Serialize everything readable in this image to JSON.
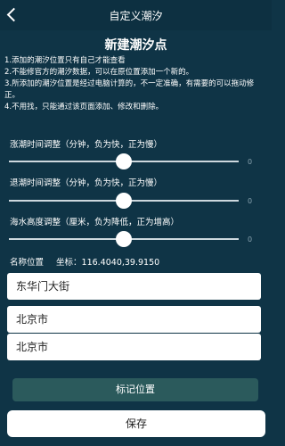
{
  "header": {
    "title": "自定义潮汐",
    "back_icon": "chevron-left-icon"
  },
  "main_title": "新建潮汐点",
  "notes": [
    "1.添加的潮汐位置只有自己才能查看",
    "2.不能修官方的潮汐数据，可以在原位置添加一个新的。",
    "3.所添加的潮汐位置是经过电脑计算的，不一定准确，有需要的可以拖动修正。",
    "4.不用找，只能通过该页面添加、修改和删除。"
  ],
  "sliders": [
    {
      "label": "涨潮时间调整（分钟，负为快，正为慢）",
      "value": "0",
      "position": 0.5
    },
    {
      "label": "退潮时间调整（分钟，负为快，正为慢）",
      "value": "0",
      "position": 0.5
    },
    {
      "label": "海水高度调整（厘米，负为降低，正为增高）",
      "value": "0",
      "position": 0.5
    }
  ],
  "location": {
    "label": "名称位置",
    "coords_label": "坐标：",
    "coords": "116.4040,39.9150"
  },
  "fields": [
    {
      "value": "东华门大街"
    },
    {
      "value": "北京市"
    },
    {
      "value": "北京市"
    }
  ],
  "mark_button": "标记位置",
  "save_button": "保存",
  "colors": {
    "background": "#0f3446",
    "mark_button": "#2b5a5c"
  }
}
